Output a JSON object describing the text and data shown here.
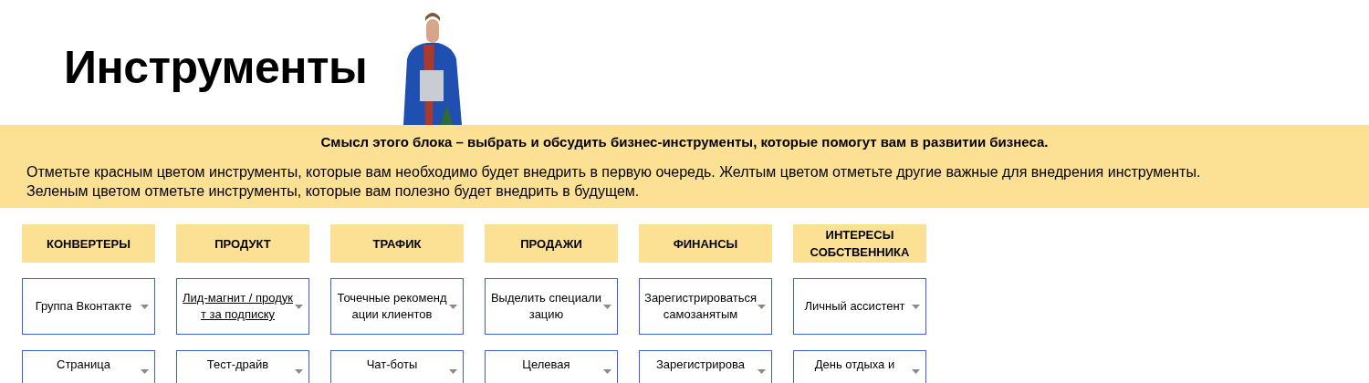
{
  "title": "Инструменты",
  "banner": {
    "heading": "Смысл этого блока – выбрать и обсудить бизнес-инструменты, которые помогут вам в развитии бизнеса.",
    "text": [
      "Отметьте красным цветом инструменты, которые вам необходимо будет внедрить в первую очередь. Желтым цветом отметьте другие важные для внедрения инструменты.",
      "Зеленым цветом отметьте инструменты, которые вам полезно будет внедрить в будущем."
    ]
  },
  "columns": [
    {
      "header": "КОНВЕРТЕРЫ",
      "items": [
        {
          "label": "Группа Вконтакте",
          "link": false
        },
        {
          "label": "Страница",
          "link": false
        }
      ]
    },
    {
      "header": "ПРОДУКТ",
      "items": [
        {
          "label": "Лид-магнит / продукт за подписку",
          "link": true
        },
        {
          "label": "Тест-драйв",
          "link": false
        }
      ]
    },
    {
      "header": "ТРАФИК",
      "items": [
        {
          "label": "Точечные рекомендации клиентов",
          "link": false
        },
        {
          "label": "Чат-боты",
          "link": false
        }
      ]
    },
    {
      "header": "ПРОДАЖИ",
      "items": [
        {
          "label": "Выделить специализацию",
          "link": false
        },
        {
          "label": "Целевая",
          "link": false
        }
      ]
    },
    {
      "header": "ФИНАНСЫ",
      "items": [
        {
          "label": "Зарегистрироваться самозанятым",
          "link": false
        },
        {
          "label": "Зарегистрирова",
          "link": false
        }
      ]
    },
    {
      "header": "ИНТЕРЕСЫ СОБСТВЕННИКА",
      "items": [
        {
          "label": "Личный ассистент",
          "link": false
        },
        {
          "label": "День отдыха и",
          "link": false
        }
      ]
    }
  ]
}
